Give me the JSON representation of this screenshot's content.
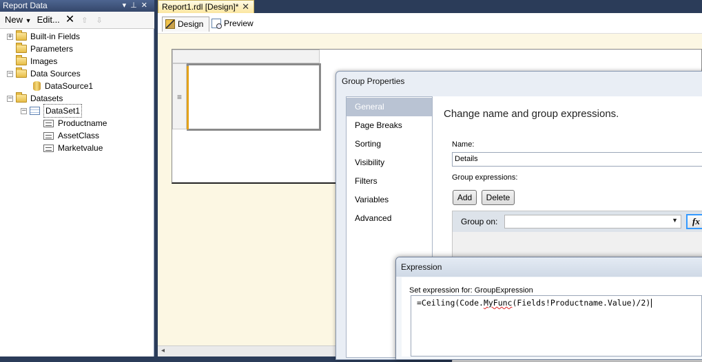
{
  "report_data_panel": {
    "title": "Report Data",
    "toolbar": {
      "new_label": "New",
      "edit_label": "Edit..."
    },
    "tree": {
      "built_in_fields": "Built-in Fields",
      "parameters": "Parameters",
      "images": "Images",
      "data_sources": "Data Sources",
      "datasource1": "DataSource1",
      "datasets": "Datasets",
      "dataset1": "DataSet1",
      "fields": [
        "Productname",
        "AssetClass",
        "Marketvalue"
      ]
    }
  },
  "document": {
    "tab_title": "Report1.rdl [Design]*",
    "design_tab": "Design",
    "preview_tab": "Preview",
    "row_handle_glyph": "≡"
  },
  "group_properties": {
    "title": "Group Properties",
    "nav": [
      "General",
      "Page Breaks",
      "Sorting",
      "Visibility",
      "Filters",
      "Variables",
      "Advanced"
    ],
    "heading": "Change name and group expressions.",
    "name_label": "Name:",
    "name_value": "Details",
    "group_expressions_label": "Group expressions:",
    "add_label": "Add",
    "delete_label": "Delete",
    "group_on_label": "Group on:",
    "group_on_value": "",
    "fx_label": "fx"
  },
  "expression_dialog": {
    "title": "Expression",
    "set_for_label": "Set expression for: GroupExpression",
    "expr_prefix": "=Ceiling(Code.",
    "expr_func": "MyFunc",
    "expr_suffix": "(Fields!Productname.Value)/2)"
  },
  "colors": {
    "titlebar": "#35476b",
    "accent": "#e3a21a",
    "nav_selected": "#b9c3d3",
    "focus_border": "#3399ff"
  }
}
